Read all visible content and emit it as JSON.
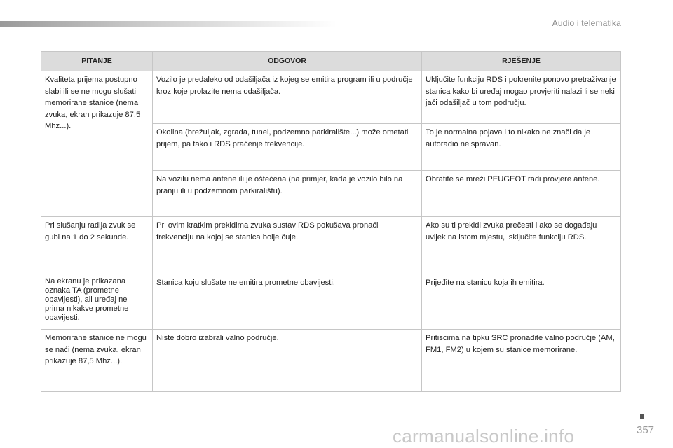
{
  "header": {
    "section_title": "Audio i telematika"
  },
  "table": {
    "columns": [
      "PITANJE",
      "ODGOVOR",
      "RJEŠENJE"
    ],
    "rows": [
      {
        "question": "Kvaliteta prijema postupno slabi ili se ne mogu slušati memorirane stanice (nema zvuka, ekran prikazuje 87,5 Mhz...).",
        "answer": "Vozilo je predaleko od odašiljača iz kojeg se emitira program ili u područje kroz koje prolazite nema odašiljača.",
        "solution": "Uključite funkciju RDS i pokrenite ponovo pretraživanje stanica kako bi uređaj mogao provjeriti nalazi li se neki jači odašiljač u tom području."
      },
      {
        "question": "",
        "answer": "Okolina (brežuljak, zgrada, tunel, podzemno parkiralište...) može ometati prijem, pa tako i RDS praćenje frekvencije.",
        "solution": "To je normalna pojava i to nikako ne znači da je autoradio neispravan."
      },
      {
        "question": "",
        "answer": "Na vozilu nema antene ili je oštećena (na primjer, kada je vozilo bilo na pranju ili u podzemnom parkiralištu).",
        "solution": "Obratite se mreži PEUGEOT radi provjere antene."
      },
      {
        "question": "Pri slušanju radija zvuk se gubi na 1 do 2 sekunde.",
        "answer": "Pri ovim kratkim prekidima zvuka sustav RDS pokušava pronaći frekvenciju na kojoj se stanica bolje čuje.",
        "solution": "Ako su ti prekidi zvuka prečesti i ako se događaju uvijek na istom mjestu, isključite funkciju RDS."
      },
      {
        "question": "Na ekranu je prikazana oznaka TA (prometne obavijesti), ali uređaj ne prima nikakve prometne obavijesti.",
        "answer": "Stanica koju slušate ne emitira prometne obavijesti.",
        "solution": "Prijeđite na stanicu koja ih emitira."
      },
      {
        "question": "Memorirane stanice ne mogu se naći (nema zvuka, ekran prikazuje 87,5 Mhz...).",
        "answer": "Niste dobro izabrali valno područje.",
        "solution": "Pritiscima na tipku SRC pronađite valno područje (AM, FM1, FM2) u kojem su stanice memorirane."
      }
    ]
  },
  "footer": {
    "page_number": "357",
    "watermark": "carmanualsonline.info"
  }
}
